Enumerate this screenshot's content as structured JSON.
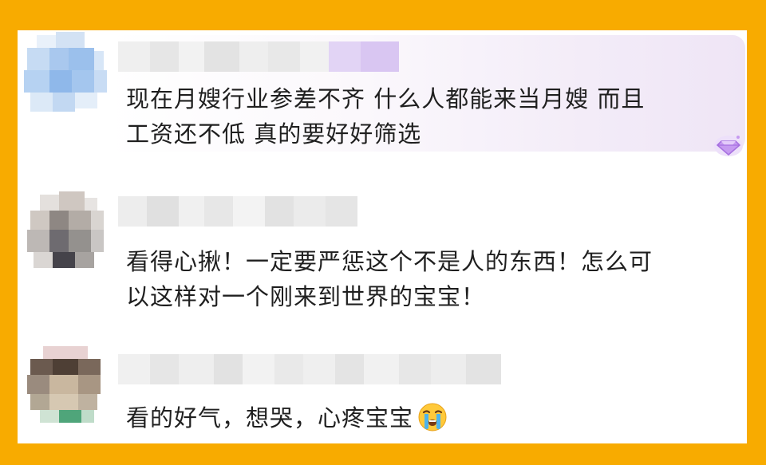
{
  "comments": [
    {
      "username": "",
      "lines": [
        "现在月嫂行业参差不齐 什么人都能来当月嫂 而且",
        "工资还不低 真的要好好筛选"
      ],
      "avatar_icon": "blurred-avatar-icon",
      "badge_icon": "purple-gem-icon"
    },
    {
      "username": "",
      "lines": [
        "看得心揪！一定要严惩这个不是人的东西！怎么可",
        "以这样对一个刚来到世界的宝宝！"
      ],
      "avatar_icon": "blurred-avatar-icon"
    },
    {
      "username": "",
      "lines": [
        "看的好气，想哭，心疼宝宝"
      ],
      "avatar_icon": "blurred-avatar-icon",
      "emoji_icon": "crying-face-icon"
    }
  ],
  "colors": {
    "frame": "#F8AB00",
    "panel": "#FFFFFF",
    "text": "#1F1F1F",
    "highlight": "#EFE5F6",
    "gem": "#B27BE6"
  }
}
